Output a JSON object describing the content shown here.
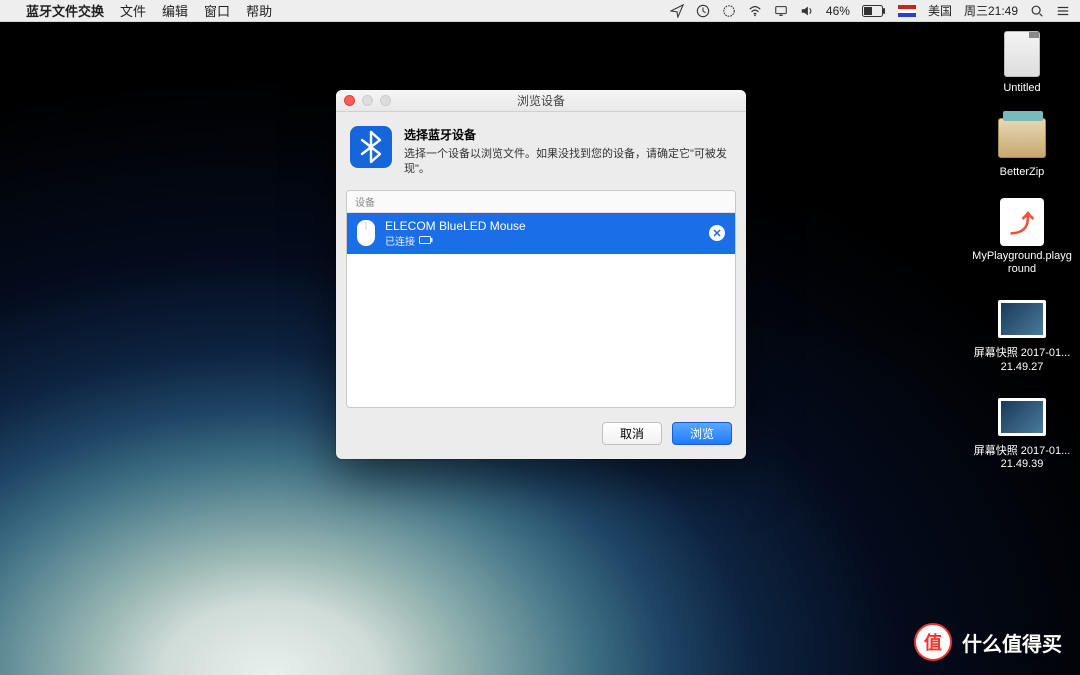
{
  "menubar": {
    "app_name": "蓝牙文件交换",
    "menus": [
      "文件",
      "编辑",
      "窗口",
      "帮助"
    ],
    "battery_pct": "46%",
    "flag_label": "美国",
    "datetime": "周三21:49"
  },
  "desktop": {
    "icons": [
      {
        "label": "Untitled"
      },
      {
        "label": "BetterZip"
      },
      {
        "label": "MyPlayground.playground"
      },
      {
        "label": "屏幕快照 2017-01...21.49.27"
      },
      {
        "label": "屏幕快照 2017-01...21.49.39"
      }
    ]
  },
  "dialog": {
    "window_title": "浏览设备",
    "heading": "选择蓝牙设备",
    "description": "选择一个设备以浏览文件。如果没找到您的设备，请确定它\"可被发现\"。",
    "list_header": "设备",
    "device": {
      "name": "ELECOM BlueLED Mouse",
      "status": "已连接"
    },
    "cancel": "取消",
    "browse": "浏览"
  },
  "watermark": {
    "badge": "值",
    "text": "什么值得买"
  }
}
